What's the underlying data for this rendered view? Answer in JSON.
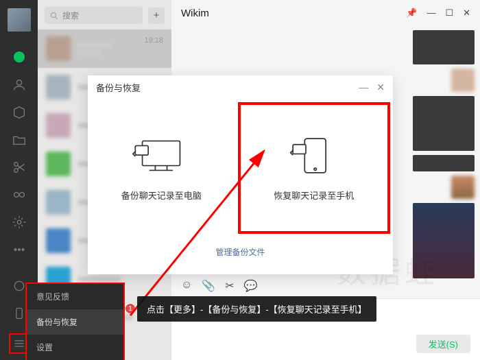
{
  "nav": {
    "icons": [
      "chat",
      "contacts",
      "cube",
      "folder",
      "scissors",
      "butterfly",
      "gear",
      "dots",
      "link",
      "phone",
      "menu"
    ]
  },
  "search": {
    "placeholder": "搜索"
  },
  "chat": {
    "title": "Wikim",
    "time": "19:18",
    "send": "发送(S)"
  },
  "modal": {
    "title": "备份与恢复",
    "opt1": "备份聊天记录至电脑",
    "opt2": "恢复聊天记录至手机",
    "manage": "管理备份文件"
  },
  "popup": {
    "feedback": "意见反馈",
    "backup": "备份与恢复",
    "settings": "设置"
  },
  "tip": "点击【更多】-【备份与恢复】-【恢复聊天记录至手机】",
  "badge": "1",
  "watermark": "数据蛙"
}
